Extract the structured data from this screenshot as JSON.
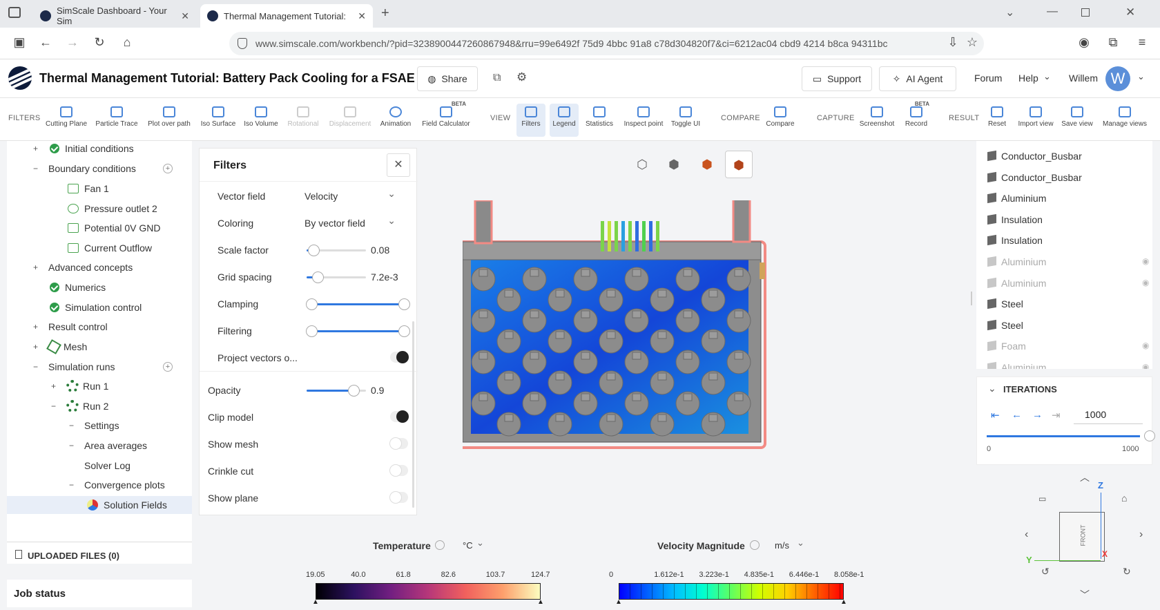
{
  "browser": {
    "tabs": [
      {
        "title": "SimScale Dashboard - Your Sim",
        "active": false
      },
      {
        "title": "Thermal Management Tutorial: ",
        "active": true
      }
    ],
    "url": "www.simscale.com/workbench/?pid=3238900447260867948&rru=99e6492f 75d9 4bbc 91a8 c78d304820f7&ci=6212ac04 cbd9 4214 b8ca 94311bc"
  },
  "header": {
    "title": "Thermal Management Tutorial: Battery Pack Cooling for a FSAE Ca...",
    "share_label": "Share",
    "support_label": "Support",
    "ai_agent_label": "AI Agent",
    "forum_label": "Forum",
    "help_label": "Help",
    "user_name": "Willem",
    "avatar_letter": "W"
  },
  "toolbar": {
    "filters_section": "FILTERS",
    "view_section": "VIEW",
    "compare_section": "COMPARE",
    "capture_section": "CAPTURE",
    "result_section": "RESULT",
    "beta": "BETA",
    "buttons": {
      "cutting_plane": "Cutting Plane",
      "particle_trace": "Particle Trace",
      "plot_over_path": "Plot over path",
      "iso_surface": "Iso Surface",
      "iso_volume": "Iso Volume",
      "rotational": "Rotational",
      "displacement": "Displacement",
      "animation": "Animation",
      "field_calculator": "Field Calculator",
      "filters": "Filters",
      "legend": "Legend",
      "statistics": "Statistics",
      "inspect_point": "Inspect point",
      "toggle_ui": "Toggle UI",
      "compare": "Compare",
      "screenshot": "Screenshot",
      "record": "Record",
      "reset": "Reset",
      "import_view": "Import view",
      "save_view": "Save view",
      "manage_views": "Manage views"
    }
  },
  "tree": {
    "initial_conditions": "Initial conditions",
    "boundary_conditions": "Boundary conditions",
    "fan": "Fan 1",
    "pressure_outlet": "Pressure outlet 2",
    "potential": "Potential 0V GND",
    "current_outflow": "Current Outflow",
    "advanced_concepts": "Advanced concepts",
    "numerics": "Numerics",
    "simulation_control": "Simulation control",
    "result_control": "Result control",
    "mesh": "Mesh",
    "simulation_runs": "Simulation runs",
    "run1": "Run 1",
    "run2": "Run 2",
    "settings": "Settings",
    "area_averages": "Area averages",
    "solver_log": "Solver Log",
    "convergence_plots": "Convergence plots",
    "solution_fields": "Solution Fields"
  },
  "uploaded_files": "UPLOADED FILES (0)",
  "job_status": "Job status",
  "filters_panel": {
    "title": "Filters",
    "vector_field_label": "Vector field",
    "vector_field_value": "Velocity",
    "coloring_label": "Coloring",
    "coloring_value": "By vector field",
    "scale_factor_label": "Scale factor",
    "scale_factor_value": "0.08",
    "grid_spacing_label": "Grid spacing",
    "grid_spacing_value": "7.2e-3",
    "clamping_label": "Clamping",
    "filtering_label": "Filtering",
    "project_vectors_label": "Project vectors o...",
    "opacity_label": "Opacity",
    "opacity_value": "0.9",
    "clip_model_label": "Clip model",
    "show_mesh_label": "Show mesh",
    "crinkle_cut_label": "Crinkle cut",
    "show_plane_label": "Show plane"
  },
  "parts_list": [
    {
      "name": "Conductor_Busbar",
      "visible": true
    },
    {
      "name": "Conductor_Busbar",
      "visible": true
    },
    {
      "name": "Aluminium",
      "visible": true
    },
    {
      "name": "Insulation",
      "visible": true
    },
    {
      "name": "Insulation",
      "visible": true
    },
    {
      "name": "Aluminium",
      "visible": false
    },
    {
      "name": "Aluminium",
      "visible": false
    },
    {
      "name": "Steel",
      "visible": true
    },
    {
      "name": "Steel",
      "visible": true
    },
    {
      "name": "Foam",
      "visible": false
    },
    {
      "name": "Aluminium",
      "visible": false
    }
  ],
  "iterations": {
    "title": "ITERATIONS",
    "value": "1000",
    "min_label": "0",
    "max_label": "1000",
    "fraction": 1.0
  },
  "nav_cube": {
    "front": "FRONT",
    "z": "Z",
    "y": "Y",
    "x": "X"
  },
  "legend_temperature": {
    "title": "Temperature",
    "unit": "°C",
    "ticks": [
      "19.05",
      "40.0",
      "61.8",
      "82.6",
      "103.7",
      "124.7"
    ]
  },
  "legend_velocity": {
    "title": "Velocity Magnitude",
    "unit": "m/s",
    "ticks": [
      "0",
      "1.612e-1",
      "3.223e-1",
      "4.835e-1",
      "6.446e-1",
      "8.058e-1"
    ]
  },
  "colors": {
    "accent": "#2f78e0",
    "check": "#2e9c4a",
    "brand": "#0d1b3a"
  }
}
